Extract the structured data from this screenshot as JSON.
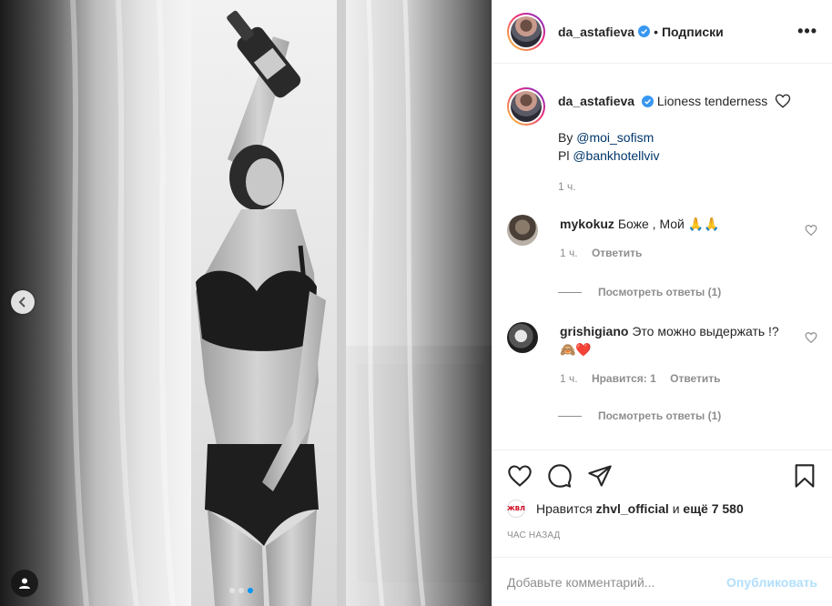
{
  "post": {
    "carousel_count": 3,
    "carousel_active": 3
  },
  "header": {
    "username": "da_astafieva",
    "separator": "•",
    "follow_label": "Подписки",
    "more_icon": "more-horizontal-icon"
  },
  "caption": {
    "username": "da_astafieva",
    "text": "Lioness tenderness",
    "line2_prefix": "By ",
    "line2_mention": "@moi_sofism",
    "line3_prefix": "Pl ",
    "line3_mention": "@bankhotellviv",
    "time": "1 ч."
  },
  "comments": [
    {
      "username": "mykokuz",
      "text": "Боже , Мой 🙏🙏",
      "time": "1 ч.",
      "reply_label": "Ответить",
      "view_replies": "Посмотреть ответы (1)"
    },
    {
      "username": "grishigiano",
      "text": "Это можно выдержать !?🙈❤️",
      "time": "1 ч.",
      "likes_label": "Нравится: 1",
      "reply_label": "Ответить",
      "view_replies": "Посмотреть ответы (1)"
    }
  ],
  "likes": {
    "avatar_text": "ЖВЛ",
    "prefix": "Нравится ",
    "user": "zhvl_official",
    "middle": " и ",
    "count": "ещё 7 580"
  },
  "posted_ago": "ЧАС НАЗАД",
  "add_comment": {
    "placeholder": "Добавьте комментарий...",
    "publish_label": "Опубликовать"
  },
  "colors": {
    "accent": "#0095f6",
    "verified": "#3897f0",
    "publish_disabled": "#b2dffc",
    "muted": "#8e8e8e"
  }
}
